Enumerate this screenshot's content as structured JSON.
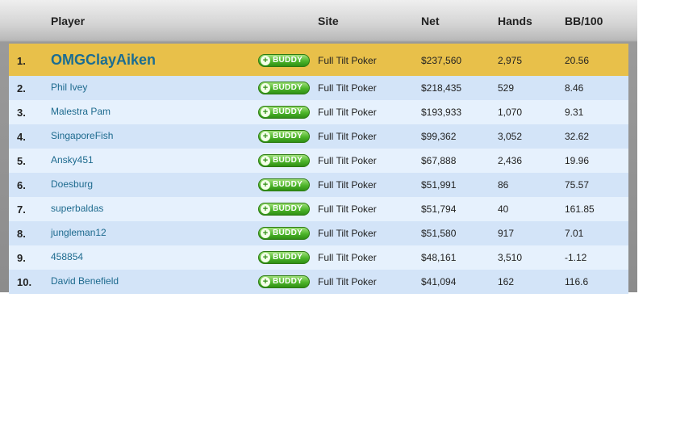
{
  "columns": {
    "player": "Player",
    "site": "Site",
    "net": "Net",
    "hands": "Hands",
    "bb100": "BB/100"
  },
  "buddy_label": "BUDDY",
  "buddy_plus": "+",
  "rows": [
    {
      "rank": "1.",
      "player": "OMGClayAiken",
      "site": "Full Tilt Poker",
      "net": "$237,560",
      "hands": "2,975",
      "bb100": "20.56"
    },
    {
      "rank": "2.",
      "player": "Phil Ivey",
      "site": "Full Tilt Poker",
      "net": "$218,435",
      "hands": "529",
      "bb100": "8.46"
    },
    {
      "rank": "3.",
      "player": "Malestra Pam",
      "site": "Full Tilt Poker",
      "net": "$193,933",
      "hands": "1,070",
      "bb100": "9.31"
    },
    {
      "rank": "4.",
      "player": "SingaporeFish",
      "site": "Full Tilt Poker",
      "net": "$99,362",
      "hands": "3,052",
      "bb100": "32.62"
    },
    {
      "rank": "5.",
      "player": "Ansky451",
      "site": "Full Tilt Poker",
      "net": "$67,888",
      "hands": "2,436",
      "bb100": "19.96"
    },
    {
      "rank": "6.",
      "player": "Doesburg",
      "site": "Full Tilt Poker",
      "net": "$51,991",
      "hands": "86",
      "bb100": "75.57"
    },
    {
      "rank": "7.",
      "player": "superbaldas",
      "site": "Full Tilt Poker",
      "net": "$51,794",
      "hands": "40",
      "bb100": "161.85"
    },
    {
      "rank": "8.",
      "player": "jungleman12",
      "site": "Full Tilt Poker",
      "net": "$51,580",
      "hands": "917",
      "bb100": "7.01"
    },
    {
      "rank": "9.",
      "player": "458854",
      "site": "Full Tilt Poker",
      "net": "$48,161",
      "hands": "3,510",
      "bb100": "-1.12"
    },
    {
      "rank": "10.",
      "player": "David Benefield",
      "site": "Full Tilt Poker",
      "net": "$41,094",
      "hands": "162",
      "bb100": "116.6"
    }
  ]
}
